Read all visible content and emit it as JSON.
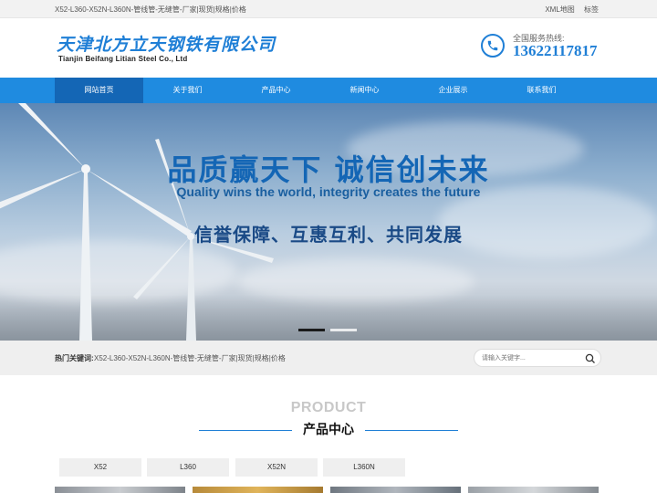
{
  "topbar": {
    "left_text": "X52-L360-X52N-L360N-管线管-无缝管-厂家|现货|规格|价格",
    "links": [
      "XML地图",
      "标签"
    ]
  },
  "header": {
    "company_cn": "天津北方立天钢铁有限公司",
    "company_en": "Tianjin Beifang Litian Steel Co., Ltd",
    "hotline_label": "全国服务热线:",
    "hotline_number": "13622117817",
    "phone_icon": "phone-icon",
    "accent_color": "#1f7fd6"
  },
  "nav": {
    "items": [
      {
        "label": "网站首页",
        "active": true
      },
      {
        "label": "关于我们"
      },
      {
        "label": "产品中心"
      },
      {
        "label": "新闻中心"
      },
      {
        "label": "企业展示"
      },
      {
        "label": "联系我们"
      }
    ],
    "bg_color": "#1f8be0",
    "active_color": "#1466b5"
  },
  "banner": {
    "headline": "品质赢天下  诚信创未来",
    "subline": "Quality wins the world, integrity creates the future",
    "motto": "信誉保障、互惠互利、共同发展",
    "slides": 2,
    "active_slide": 1
  },
  "search": {
    "label": "热门关键词:",
    "keywords": "X52-L360-X52N-L360N-管线管-无缝管-厂家|现货|规格|价格",
    "placeholder": "请输入关键字...",
    "button_icon": "search-icon"
  },
  "products": {
    "title_en": "PRODUCT",
    "title_cn": "产品中心",
    "tabs": [
      "X52",
      "L360",
      "X52N",
      "L360N"
    ]
  }
}
